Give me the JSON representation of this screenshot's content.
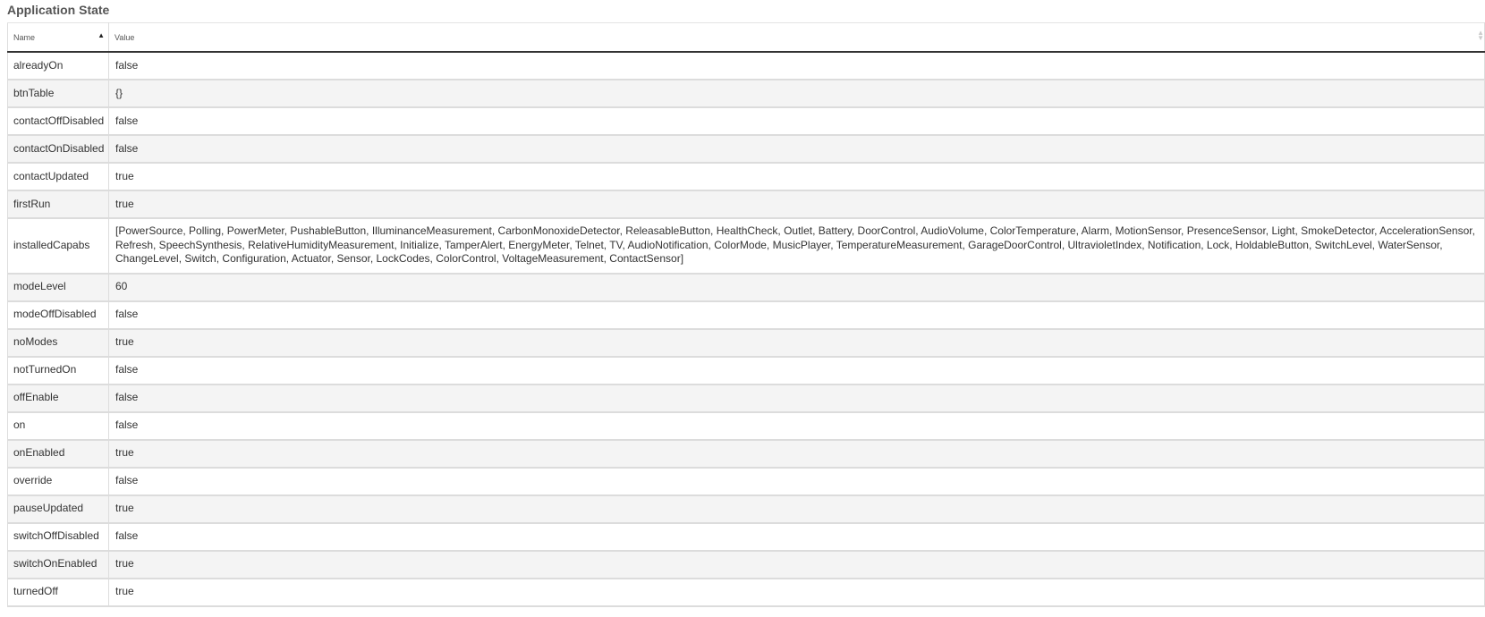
{
  "section": {
    "title": "Application State"
  },
  "table": {
    "columns": {
      "name": "Name",
      "value": "Value"
    },
    "sort": {
      "column": "name",
      "direction": "ascending"
    },
    "rows": [
      {
        "name": "alreadyOn",
        "value": "false"
      },
      {
        "name": "btnTable",
        "value": "{}"
      },
      {
        "name": "contactOffDisabled",
        "value": "false"
      },
      {
        "name": "contactOnDisabled",
        "value": "false"
      },
      {
        "name": "contactUpdated",
        "value": "true"
      },
      {
        "name": "firstRun",
        "value": "true"
      },
      {
        "name": "installedCapabs",
        "value": "[PowerSource, Polling, PowerMeter, PushableButton, IlluminanceMeasurement, CarbonMonoxideDetector, ReleasableButton, HealthCheck, Outlet, Battery, DoorControl, AudioVolume, ColorTemperature, Alarm, MotionSensor, PresenceSensor, Light, SmokeDetector, AccelerationSensor, Refresh, SpeechSynthesis, RelativeHumidityMeasurement, Initialize, TamperAlert, EnergyMeter, Telnet, TV, AudioNotification, ColorMode, MusicPlayer, TemperatureMeasurement, GarageDoorControl, UltravioletIndex, Notification, Lock, HoldableButton, SwitchLevel, WaterSensor, ChangeLevel, Switch, Configuration, Actuator, Sensor, LockCodes, ColorControl, VoltageMeasurement, ContactSensor]",
        "wrap": true
      },
      {
        "name": "modeLevel",
        "value": "60"
      },
      {
        "name": "modeOffDisabled",
        "value": "false"
      },
      {
        "name": "noModes",
        "value": "true"
      },
      {
        "name": "notTurnedOn",
        "value": "false"
      },
      {
        "name": "offEnable",
        "value": "false"
      },
      {
        "name": "on",
        "value": "false"
      },
      {
        "name": "onEnabled",
        "value": "true"
      },
      {
        "name": "override",
        "value": "false"
      },
      {
        "name": "pauseUpdated",
        "value": "true"
      },
      {
        "name": "switchOffDisabled",
        "value": "false"
      },
      {
        "name": "switchOnEnabled",
        "value": "true"
      },
      {
        "name": "turnedOff",
        "value": "true"
      }
    ]
  }
}
